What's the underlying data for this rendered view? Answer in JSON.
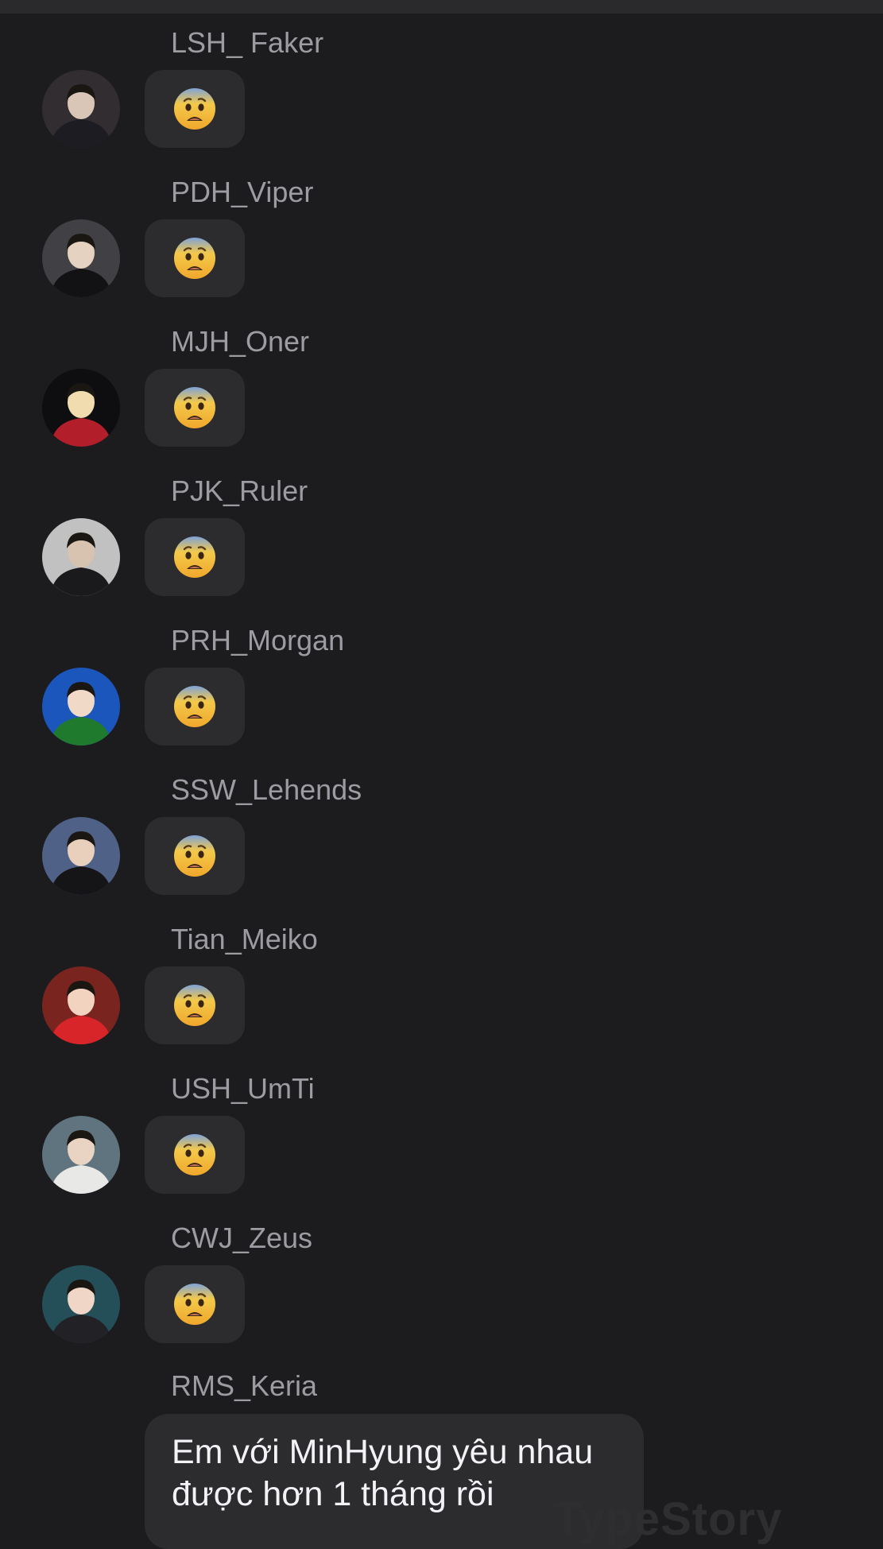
{
  "chat": {
    "messages": [
      {
        "sender": "LSH_ Faker",
        "content": "😨",
        "avatar_colors": [
          "#3a3438",
          "#1c1c22",
          "#d9c6b6"
        ]
      },
      {
        "sender": "PDH_Viper",
        "content": "😨",
        "avatar_colors": [
          "#4b4b4f",
          "#121214",
          "#e6d2c0"
        ]
      },
      {
        "sender": "MJH_Oner",
        "content": "😨",
        "avatar_colors": [
          "#101014",
          "#b21f2a",
          "#f0dcae"
        ]
      },
      {
        "sender": "PJK_Ruler",
        "content": "😨",
        "avatar_colors": [
          "#dcdcdc",
          "#1a1a1c",
          "#d8c2b0"
        ]
      },
      {
        "sender": "PRH_Morgan",
        "content": "😨",
        "avatar_colors": [
          "#1f62d8",
          "#1f7a2e",
          "#f1d9c8"
        ]
      },
      {
        "sender": "SSW_Lehends",
        "content": "😨",
        "avatar_colors": [
          "#5a6f9a",
          "#151518",
          "#e8d0bd"
        ]
      },
      {
        "sender": "Tian_Meiko",
        "content": "😨",
        "avatar_colors": [
          "#8a2a24",
          "#d8252a",
          "#f2d3bf"
        ]
      },
      {
        "sender": "USH_UmTi",
        "content": "😨",
        "avatar_colors": [
          "#6d8590",
          "#e8e8e6",
          "#e9d4c4"
        ]
      },
      {
        "sender": "CWJ_Zeus",
        "content": "😨",
        "avatar_colors": [
          "#2a5a66",
          "#222226",
          "#f0d6c6"
        ]
      }
    ],
    "last_message": {
      "sender": "RMS_Keria",
      "text": "Em với MinHyung yêu nhau được hơn 1 tháng rồi"
    }
  },
  "watermark": "TypeStory",
  "colors": {
    "background": "#1c1c1e",
    "bubble": "#2c2c2e",
    "sender_name": "#9c9ca2",
    "message_text": "#f2f2f7"
  },
  "icons": {
    "reaction": "fearful-face-emoji"
  }
}
